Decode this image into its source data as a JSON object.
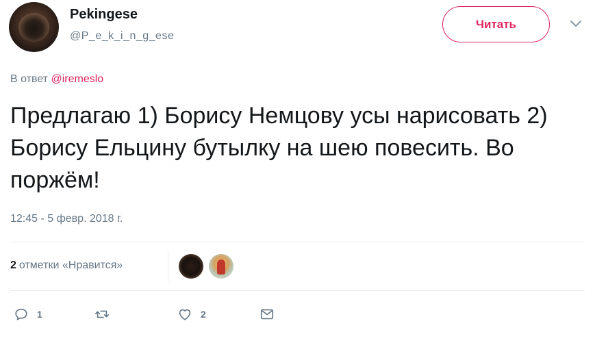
{
  "author": {
    "name": "Pekingese",
    "handle": "@P_e_k_i_n_g_ese"
  },
  "follow_button_label": "Читать",
  "reply_context": {
    "prefix": "В ответ",
    "mention": "@iremeslo"
  },
  "tweet": {
    "text": "Предлагаю 1) Борису Немцову усы нарисовать 2) Борису Ельцину бутылку на шею повесить. Во поржём!",
    "timestamp": "12:45 - 5 февр. 2018 г."
  },
  "stats": {
    "likes_count": "2",
    "likes_label": "отметки «Нравится»"
  },
  "actions": {
    "reply_count": "1",
    "retweet_count": "",
    "like_count": "2"
  },
  "colors": {
    "accent": "#e0245e",
    "secondary_text": "#657786",
    "primary_text": "#14171a",
    "divider": "#e6ecf0"
  },
  "icons": {
    "reply": "reply-icon",
    "retweet": "retweet-icon",
    "like": "heart-icon",
    "dm": "envelope-icon",
    "menu": "chevron-down-icon"
  }
}
